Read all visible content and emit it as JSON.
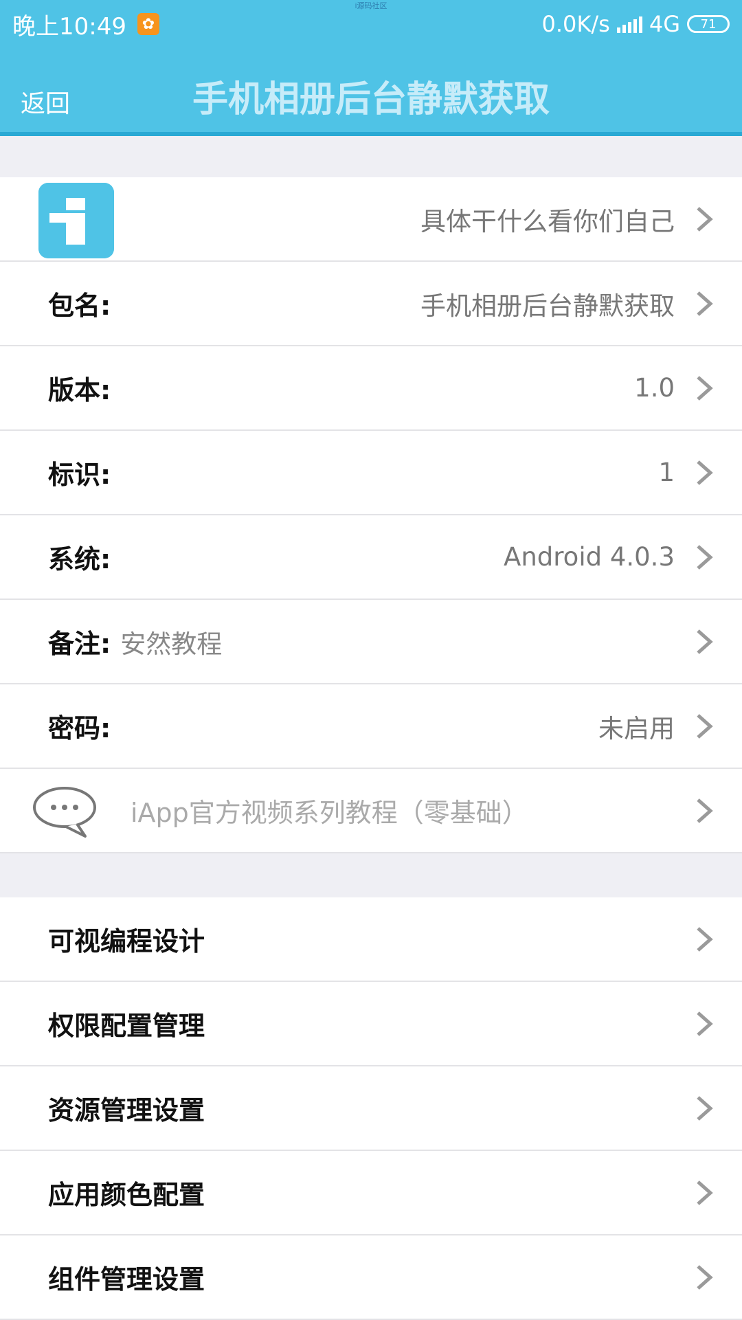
{
  "status_bar": {
    "time": "晚上10:49",
    "watermark": "i源码社区",
    "network_speed": "0.0K/s",
    "network_type": "4G",
    "battery": "71"
  },
  "header": {
    "back_label": "返回",
    "title": "手机相册后台静默获取"
  },
  "info": {
    "description": "具体干什么看你们自己",
    "package_label": "包名:",
    "package_value": "手机相册后台静默获取",
    "version_label": "版本:",
    "version_value": "1.0",
    "id_label": "标识:",
    "id_value": "1",
    "system_label": "系统:",
    "system_value": "Android 4.0.3",
    "note_label": "备注:",
    "note_value": "安然教程",
    "password_label": "密码:",
    "password_value": "未启用",
    "tutorial_link": "iApp官方视频系列教程（零基础）"
  },
  "menu": {
    "items": [
      {
        "label": "可视编程设计"
      },
      {
        "label": "权限配置管理"
      },
      {
        "label": "资源管理设置"
      },
      {
        "label": "应用颜色配置"
      },
      {
        "label": "组件管理设置"
      }
    ]
  },
  "icons": {
    "app": "app-info-icon",
    "chat": "chat-bubble-icon",
    "chevron": "chevron-right-icon"
  },
  "colors": {
    "primary": "#4fc3e6",
    "title_text": "#c7ecf9",
    "background": "#efeff4"
  }
}
